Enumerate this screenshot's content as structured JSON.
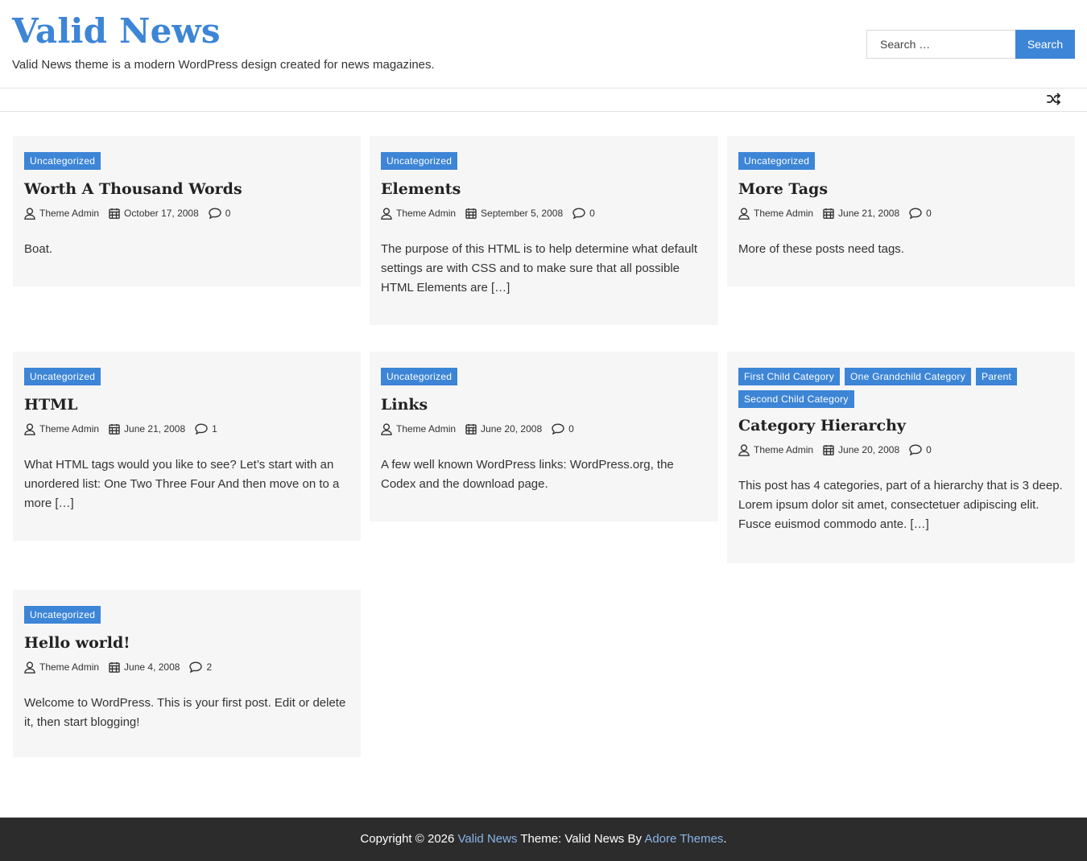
{
  "header": {
    "site_title": "Valid News",
    "tagline": "Valid News theme is a modern WordPress design created for news magazines."
  },
  "search": {
    "placeholder": "Search …",
    "button_label": "Search"
  },
  "nav": {
    "random_icon": "random-shuffle-icon"
  },
  "posts": [
    {
      "categories": [
        "Uncategorized"
      ],
      "title": "Worth A Thousand Words",
      "author": "Theme Admin",
      "date": "October 17, 2008",
      "comments": "0",
      "excerpt": "Boat."
    },
    {
      "categories": [
        "Uncategorized"
      ],
      "title": "Elements",
      "author": "Theme Admin",
      "date": "September 5, 2008",
      "comments": "0",
      "excerpt": "The purpose of this HTML is to help determine what default settings are with CSS and to make sure that all possible HTML Elements are […]"
    },
    {
      "categories": [
        "Uncategorized"
      ],
      "title": "More Tags",
      "author": "Theme Admin",
      "date": "June 21, 2008",
      "comments": "0",
      "excerpt": "More of these posts need tags."
    },
    {
      "categories": [
        "Uncategorized"
      ],
      "title": "HTML",
      "author": "Theme Admin",
      "date": "June 21, 2008",
      "comments": "1",
      "excerpt": "What HTML tags would you like to see? Let’s start with an unordered list: One Two Three Four And then move on to a more […]"
    },
    {
      "categories": [
        "Uncategorized"
      ],
      "title": "Links",
      "author": "Theme Admin",
      "date": "June 20, 2008",
      "comments": "0",
      "excerpt": "A few well known WordPress links: WordPress.org, the Codex and the download page."
    },
    {
      "categories": [
        "First Child Category",
        "One Grandchild Category",
        "Parent",
        "Second Child Category"
      ],
      "title": "Category Hierarchy",
      "author": "Theme Admin",
      "date": "June 20, 2008",
      "comments": "0",
      "excerpt": "This post has 4 categories, part of a hierarchy that is 3 deep. Lorem ipsum dolor sit amet, consectetuer adipiscing elit. Fusce euismod commodo ante. […]"
    },
    {
      "categories": [
        "Uncategorized"
      ],
      "title": "Hello world!",
      "author": "Theme Admin",
      "date": "June 4, 2008",
      "comments": "2",
      "excerpt": "Welcome to WordPress. This is your first post. Edit or delete it, then start blogging!"
    }
  ],
  "footer": {
    "copyright": "Copyright © 2026",
    "site_link": "Valid News",
    "theme_text": "Theme: Valid News By",
    "author_link": "Adore Themes",
    "period": "."
  },
  "colors": {
    "accent": "#3d85d6",
    "card_bg": "#f6f6f6",
    "footer_bg": "#2c2c2c"
  }
}
